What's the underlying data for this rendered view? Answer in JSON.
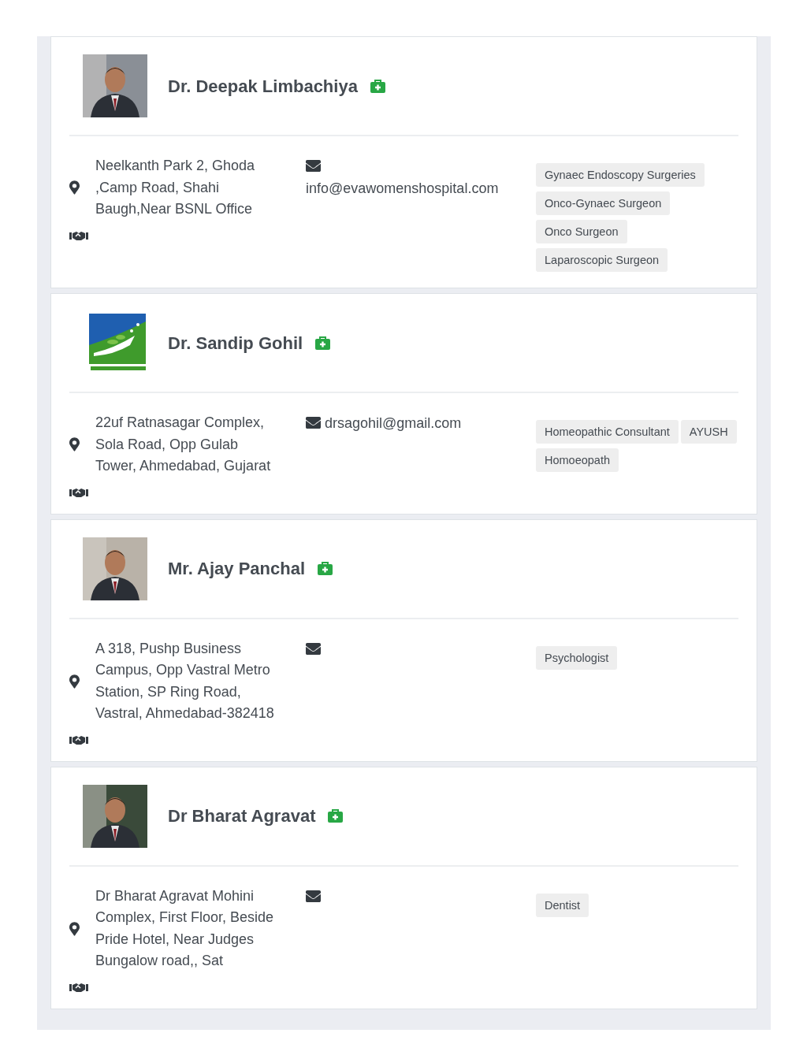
{
  "doctors": [
    {
      "name": "Dr. Deepak Limbachiya",
      "address": "Neelkanth Park 2, Ghoda ,Camp Road, Shahi Baugh,Near BSNL Office",
      "email": "info@evawomenshospital.com",
      "tags": [
        "Gynaec Endoscopy Surgeries",
        "Onco-Gynaec Surgeon",
        "Onco Surgeon",
        "Laparoscopic Surgeon"
      ]
    },
    {
      "name": "Dr. Sandip Gohil",
      "photo": {
        "kind": "logo"
      },
      "address": "22uf Ratnasagar Complex, Sola Road, Opp Gulab Tower, Ahmedabad, Gujarat",
      "email": "drsagohil@gmail.com",
      "tags": [
        "Homeopathic Consultant",
        "AYUSH",
        "Homoeopath"
      ]
    },
    {
      "name": "Mr. Ajay Panchal",
      "address": "A 318, Pushp Business Campus, Opp Vastral Metro Station, SP Ring Road, Vastral, Ahmedabad-382418",
      "tags": [
        "Psychologist"
      ]
    },
    {
      "name": "Dr Bharat Agravat",
      "address": "Dr Bharat Agravat Mohini Complex, First Floor, Beside Pride Hotel, Near Judges Bungalow road,, Sat",
      "tags": [
        "Dentist"
      ]
    }
  ]
}
